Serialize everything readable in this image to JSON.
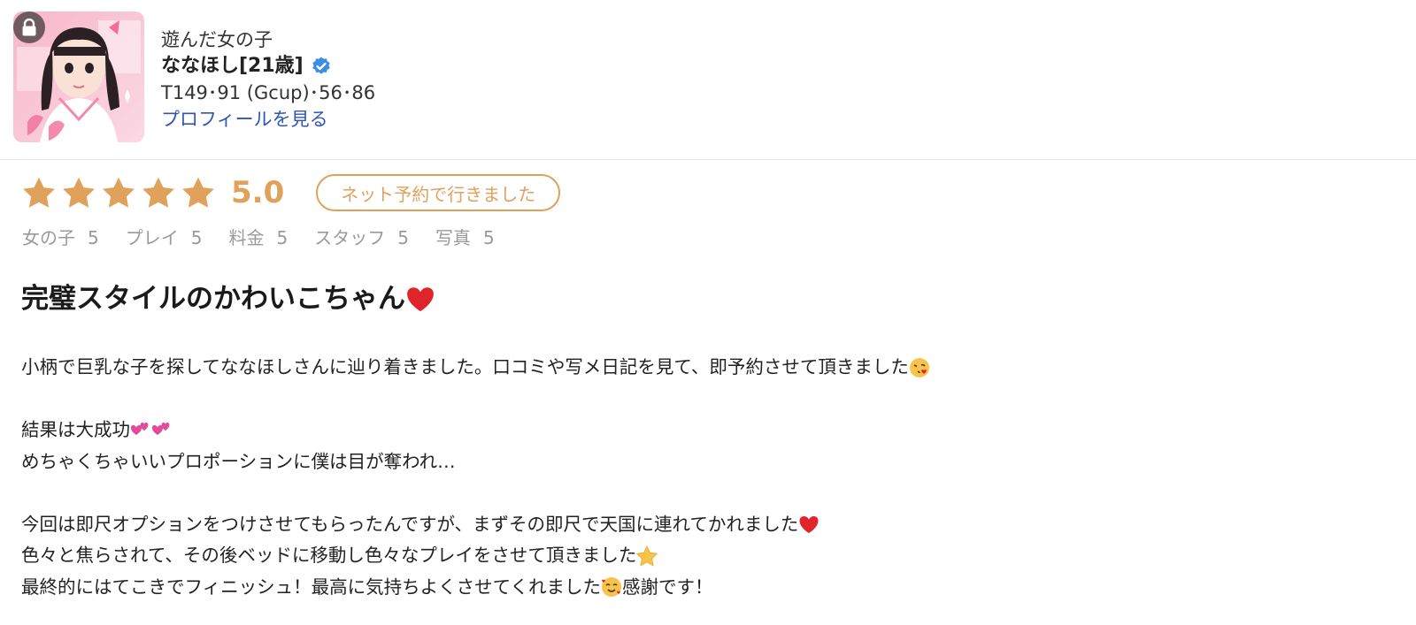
{
  "girl": {
    "label": "遊んだ女の子",
    "name": "ななほし[21歳]",
    "specs": "T149･91 (Gcup)･56･86",
    "profile_link": "プロフィールを見る",
    "photo_icon": "girl-photo",
    "lock_icon": "lock-icon",
    "verified_icon": "verified-check-icon"
  },
  "rating": {
    "stars_filled": 5,
    "stars_total": 5,
    "score": "5.0",
    "badge": "ネット予約で行きました",
    "star_color": "#e0a15a"
  },
  "subscores": [
    {
      "label": "女の子",
      "value": "5"
    },
    {
      "label": "プレイ",
      "value": "5"
    },
    {
      "label": "料金",
      "value": "5"
    },
    {
      "label": "スタッフ",
      "value": "5"
    },
    {
      "label": "写真",
      "value": "5"
    }
  ],
  "review": {
    "title": "完璧スタイルのかわいこちゃん",
    "title_emoji": "red-heart-icon",
    "lines": [
      "小柄で巨乳な子を探してななほしさんに辿り着きました。口コミや写メ日記を見て、即予約させて頂きました",
      "",
      "結果は大成功",
      "めちゃくちゃいいプロポーションに僕は目が奪われ…",
      "",
      "今回は即尺オプションをつけさせてもらったんですが、まずその即尺で天国に連れてかれました",
      "色々と焦らされて、その後ベッドに移動し色々なプレイをさせて頂きました",
      "最終的にはてこきでフィニッシュ！最高に気持ちよくさせてくれました",
      "感謝です！"
    ],
    "line_emojis": [
      "kiss-face-icon",
      "",
      "two-hearts-icon",
      "",
      "",
      "red-heart-icon",
      "star-icon",
      "smiling-hearts-face-icon",
      ""
    ]
  }
}
